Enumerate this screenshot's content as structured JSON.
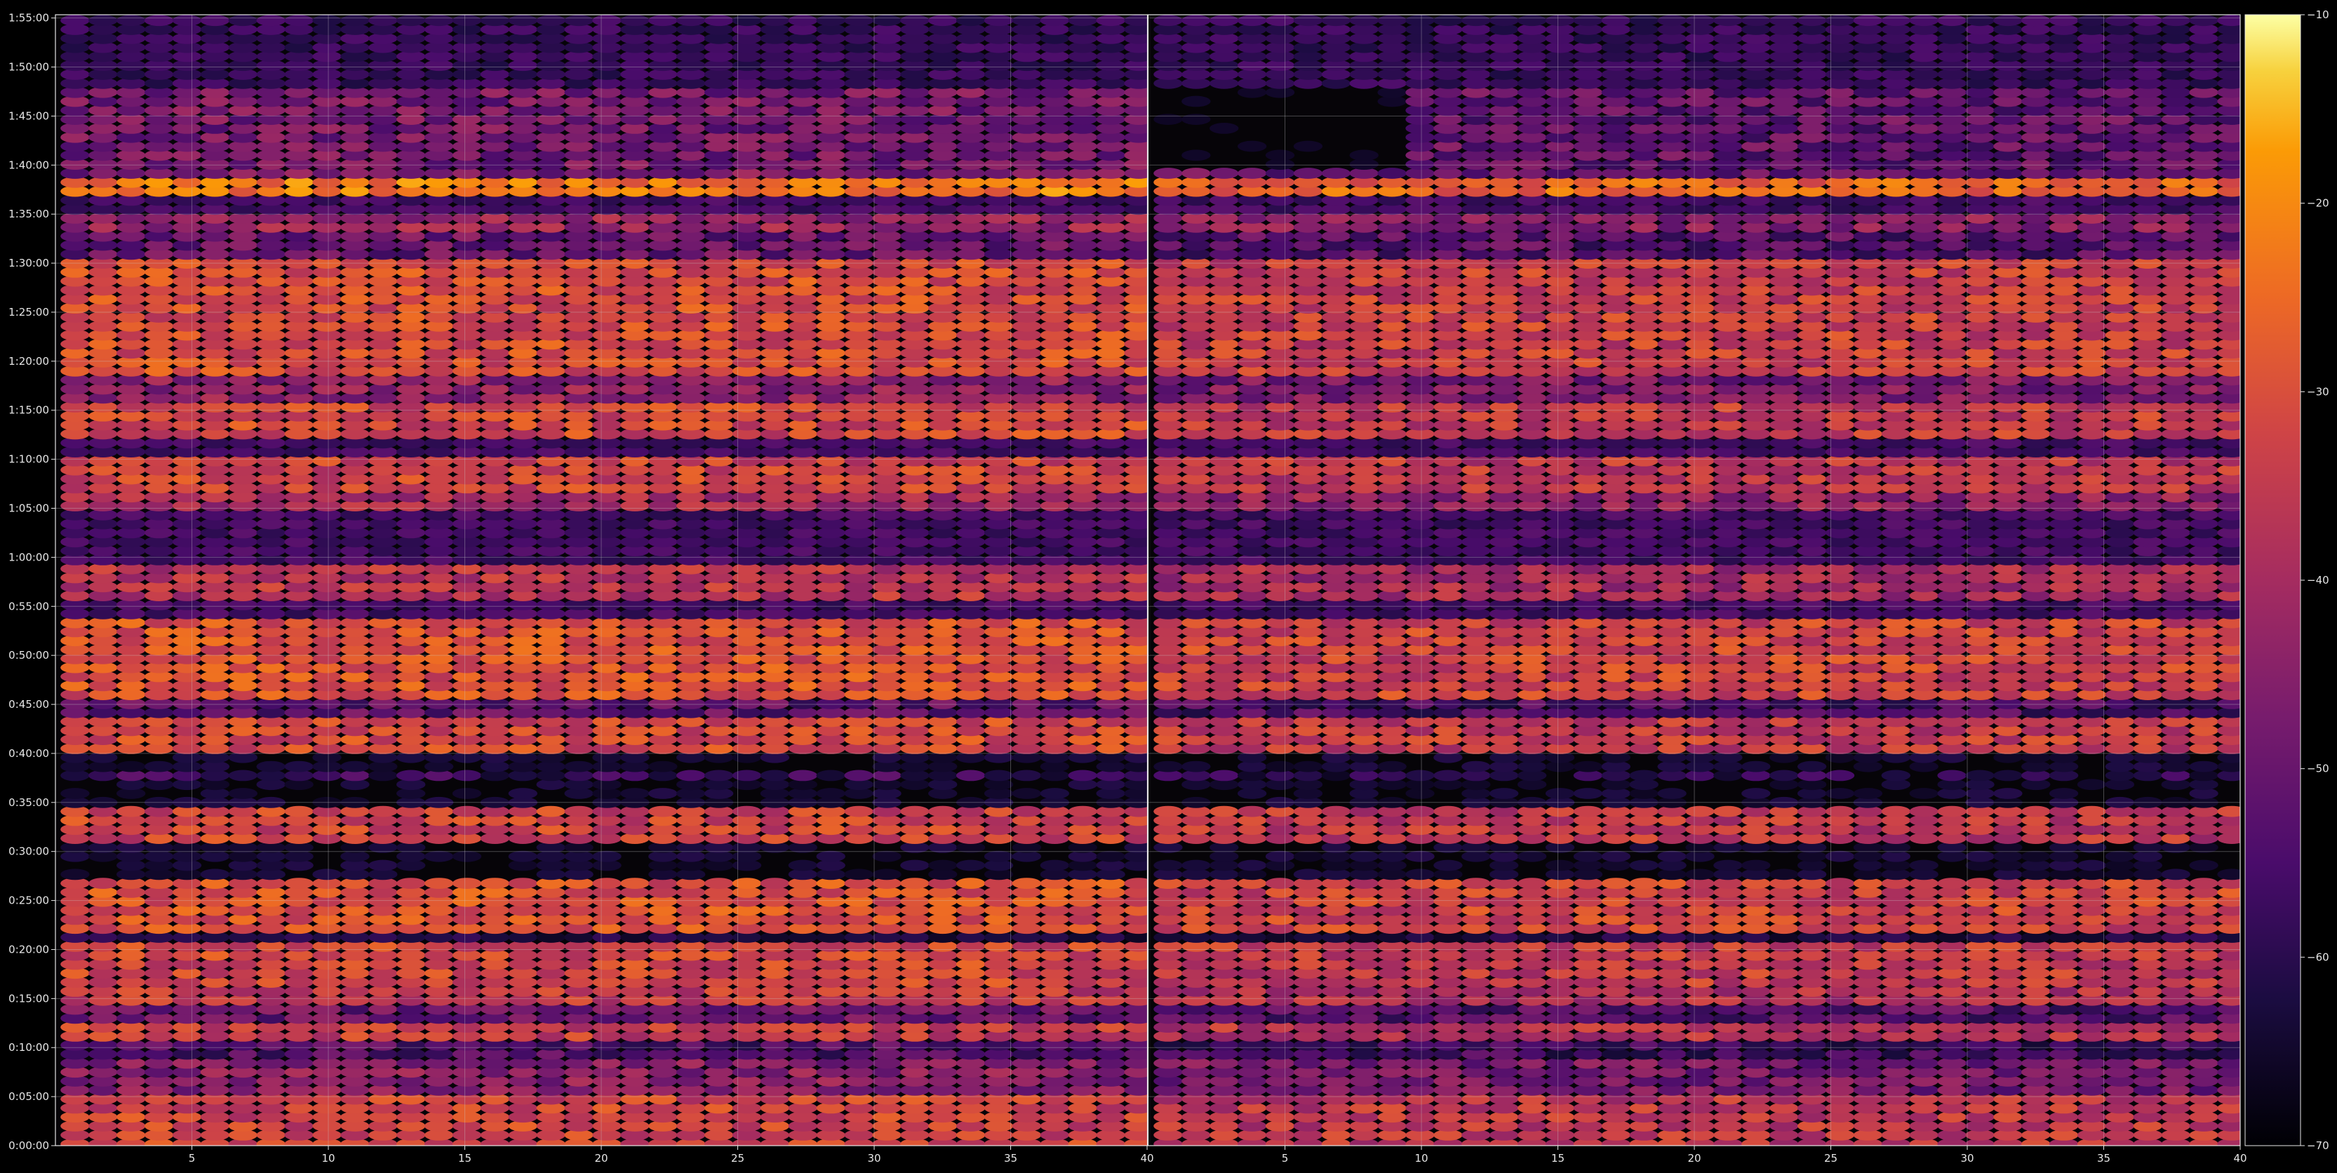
{
  "chart_data": {
    "type": "heatmap",
    "title": "",
    "xlabel": "",
    "ylabel": "",
    "panels": [
      {
        "name": "",
        "x_range": [
          1,
          40
        ]
      },
      {
        "name": "",
        "x_range": [
          1,
          40
        ]
      }
    ],
    "x_ticks": [
      5,
      10,
      15,
      20,
      25,
      30,
      35,
      40
    ],
    "y_ticks_seconds": [
      0,
      300,
      600,
      900,
      1200,
      1500,
      1800,
      2100,
      2400,
      2700,
      3000,
      3300,
      3600,
      3900,
      4200,
      4500,
      4800,
      5100,
      5400,
      5700,
      6000,
      6300,
      6600,
      6900
    ],
    "y_tick_labels": [
      "0:00:00",
      "0:05:00",
      "0:10:00",
      "0:15:00",
      "0:20:00",
      "0:25:00",
      "0:30:00",
      "0:35:00",
      "0:40:00",
      "0:45:00",
      "0:50:00",
      "0:55:00",
      "1:00:00",
      "1:05:00",
      "1:10:00",
      "1:15:00",
      "1:20:00",
      "1:25:00",
      "1:30:00",
      "1:35:00",
      "1:40:00",
      "1:45:00",
      "1:50:00",
      "1:55:00"
    ],
    "ylim_seconds": [
      0,
      6920
    ],
    "grid": true,
    "colormap": "inferno",
    "colorbar": {
      "min": -70,
      "max": -10,
      "ticks": [
        -70,
        -60,
        -50,
        -40,
        -30,
        -20,
        -10
      ],
      "tick_labels": [
        "−70",
        "−60",
        "−50",
        "−40",
        "−30",
        "−20",
        "−10"
      ]
    },
    "bands": [
      {
        "t0": 0,
        "t1": 330,
        "level": -33
      },
      {
        "t0": 330,
        "t1": 560,
        "level": -45
      },
      {
        "t0": 560,
        "t1": 640,
        "level": -54
      },
      {
        "t0": 640,
        "t1": 760,
        "level": -34
      },
      {
        "t0": 760,
        "t1": 860,
        "level": -50
      },
      {
        "t0": 860,
        "t1": 980,
        "level": -35
      },
      {
        "t0": 980,
        "t1": 1000,
        "level": -68
      },
      {
        "t0": 1000,
        "t1": 1260,
        "level": -32
      },
      {
        "t0": 1260,
        "t1": 1310,
        "level": -66
      },
      {
        "t0": 1310,
        "t1": 1660,
        "level": -30
      },
      {
        "t0": 1660,
        "t1": 1840,
        "level": -69
      },
      {
        "t0": 1840,
        "t1": 2060,
        "level": -33
      },
      {
        "t0": 2060,
        "t1": 2250,
        "level": -69
      },
      {
        "t0": 2250,
        "t1": 2310,
        "level": -58
      },
      {
        "t0": 2310,
        "t1": 2420,
        "level": -69
      },
      {
        "t0": 2420,
        "t1": 2620,
        "level": -32
      },
      {
        "t0": 2620,
        "t1": 2760,
        "level": -52
      },
      {
        "t0": 2760,
        "t1": 3240,
        "level": -30
      },
      {
        "t0": 3240,
        "t1": 3360,
        "level": -60
      },
      {
        "t0": 3360,
        "t1": 3560,
        "level": -37
      },
      {
        "t0": 3560,
        "t1": 3890,
        "level": -60
      },
      {
        "t0": 3890,
        "t1": 3990,
        "level": -40
      },
      {
        "t0": 3990,
        "t1": 4220,
        "level": -33
      },
      {
        "t0": 4220,
        "t1": 4310,
        "level": -60
      },
      {
        "t0": 4310,
        "t1": 4540,
        "level": -32
      },
      {
        "t0": 4540,
        "t1": 4700,
        "level": -44
      },
      {
        "t0": 4700,
        "t1": 5430,
        "level": -31
      },
      {
        "t0": 5430,
        "t1": 5600,
        "level": -50
      },
      {
        "t0": 5600,
        "t1": 5710,
        "level": -42
      },
      {
        "t0": 5710,
        "t1": 5820,
        "level": -60
      },
      {
        "t0": 5820,
        "t1": 5900,
        "level": -23
      },
      {
        "t0": 5900,
        "t1": 5990,
        "level": -47
      },
      {
        "t0": 5990,
        "t1": 6500,
        "level": -48
      },
      {
        "t0": 6500,
        "t1": 6920,
        "level": -62
      }
    ],
    "panel_offsets": [
      0,
      -3
    ],
    "early_bar_cutoff": [
      null,
      1
    ],
    "gap_band": {
      "t0": 5990,
      "t1": 6500,
      "panel": 1,
      "x_max": 9,
      "level": -69
    }
  }
}
